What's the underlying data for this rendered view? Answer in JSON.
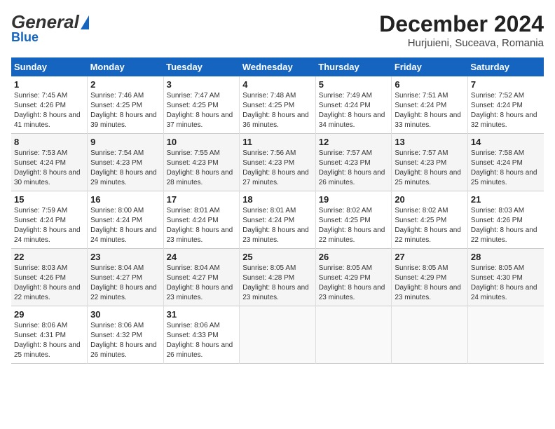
{
  "header": {
    "logo_general": "General",
    "logo_blue": "Blue",
    "title": "December 2024",
    "subtitle": "Hurjuieni, Suceava, Romania"
  },
  "calendar": {
    "days_of_week": [
      "Sunday",
      "Monday",
      "Tuesday",
      "Wednesday",
      "Thursday",
      "Friday",
      "Saturday"
    ],
    "weeks": [
      [
        {
          "day": "",
          "sunrise": "",
          "sunset": "",
          "daylight": ""
        },
        {
          "day": "2",
          "sunrise": "Sunrise: 7:46 AM",
          "sunset": "Sunset: 4:25 PM",
          "daylight": "Daylight: 8 hours and 39 minutes."
        },
        {
          "day": "3",
          "sunrise": "Sunrise: 7:47 AM",
          "sunset": "Sunset: 4:25 PM",
          "daylight": "Daylight: 8 hours and 37 minutes."
        },
        {
          "day": "4",
          "sunrise": "Sunrise: 7:48 AM",
          "sunset": "Sunset: 4:25 PM",
          "daylight": "Daylight: 8 hours and 36 minutes."
        },
        {
          "day": "5",
          "sunrise": "Sunrise: 7:49 AM",
          "sunset": "Sunset: 4:24 PM",
          "daylight": "Daylight: 8 hours and 34 minutes."
        },
        {
          "day": "6",
          "sunrise": "Sunrise: 7:51 AM",
          "sunset": "Sunset: 4:24 PM",
          "daylight": "Daylight: 8 hours and 33 minutes."
        },
        {
          "day": "7",
          "sunrise": "Sunrise: 7:52 AM",
          "sunset": "Sunset: 4:24 PM",
          "daylight": "Daylight: 8 hours and 32 minutes."
        }
      ],
      [
        {
          "day": "1",
          "sunrise": "Sunrise: 7:45 AM",
          "sunset": "Sunset: 4:26 PM",
          "daylight": "Daylight: 8 hours and 41 minutes."
        },
        {
          "day": "",
          "sunrise": "",
          "sunset": "",
          "daylight": ""
        },
        {
          "day": "",
          "sunrise": "",
          "sunset": "",
          "daylight": ""
        },
        {
          "day": "",
          "sunrise": "",
          "sunset": "",
          "daylight": ""
        },
        {
          "day": "",
          "sunrise": "",
          "sunset": "",
          "daylight": ""
        },
        {
          "day": "",
          "sunrise": "",
          "sunset": "",
          "daylight": ""
        },
        {
          "day": "",
          "sunrise": "",
          "sunset": "",
          "daylight": ""
        }
      ],
      [
        {
          "day": "8",
          "sunrise": "Sunrise: 7:53 AM",
          "sunset": "Sunset: 4:24 PM",
          "daylight": "Daylight: 8 hours and 30 minutes."
        },
        {
          "day": "9",
          "sunrise": "Sunrise: 7:54 AM",
          "sunset": "Sunset: 4:23 PM",
          "daylight": "Daylight: 8 hours and 29 minutes."
        },
        {
          "day": "10",
          "sunrise": "Sunrise: 7:55 AM",
          "sunset": "Sunset: 4:23 PM",
          "daylight": "Daylight: 8 hours and 28 minutes."
        },
        {
          "day": "11",
          "sunrise": "Sunrise: 7:56 AM",
          "sunset": "Sunset: 4:23 PM",
          "daylight": "Daylight: 8 hours and 27 minutes."
        },
        {
          "day": "12",
          "sunrise": "Sunrise: 7:57 AM",
          "sunset": "Sunset: 4:23 PM",
          "daylight": "Daylight: 8 hours and 26 minutes."
        },
        {
          "day": "13",
          "sunrise": "Sunrise: 7:57 AM",
          "sunset": "Sunset: 4:23 PM",
          "daylight": "Daylight: 8 hours and 25 minutes."
        },
        {
          "day": "14",
          "sunrise": "Sunrise: 7:58 AM",
          "sunset": "Sunset: 4:24 PM",
          "daylight": "Daylight: 8 hours and 25 minutes."
        }
      ],
      [
        {
          "day": "15",
          "sunrise": "Sunrise: 7:59 AM",
          "sunset": "Sunset: 4:24 PM",
          "daylight": "Daylight: 8 hours and 24 minutes."
        },
        {
          "day": "16",
          "sunrise": "Sunrise: 8:00 AM",
          "sunset": "Sunset: 4:24 PM",
          "daylight": "Daylight: 8 hours and 24 minutes."
        },
        {
          "day": "17",
          "sunrise": "Sunrise: 8:01 AM",
          "sunset": "Sunset: 4:24 PM",
          "daylight": "Daylight: 8 hours and 23 minutes."
        },
        {
          "day": "18",
          "sunrise": "Sunrise: 8:01 AM",
          "sunset": "Sunset: 4:24 PM",
          "daylight": "Daylight: 8 hours and 23 minutes."
        },
        {
          "day": "19",
          "sunrise": "Sunrise: 8:02 AM",
          "sunset": "Sunset: 4:25 PM",
          "daylight": "Daylight: 8 hours and 22 minutes."
        },
        {
          "day": "20",
          "sunrise": "Sunrise: 8:02 AM",
          "sunset": "Sunset: 4:25 PM",
          "daylight": "Daylight: 8 hours and 22 minutes."
        },
        {
          "day": "21",
          "sunrise": "Sunrise: 8:03 AM",
          "sunset": "Sunset: 4:26 PM",
          "daylight": "Daylight: 8 hours and 22 minutes."
        }
      ],
      [
        {
          "day": "22",
          "sunrise": "Sunrise: 8:03 AM",
          "sunset": "Sunset: 4:26 PM",
          "daylight": "Daylight: 8 hours and 22 minutes."
        },
        {
          "day": "23",
          "sunrise": "Sunrise: 8:04 AM",
          "sunset": "Sunset: 4:27 PM",
          "daylight": "Daylight: 8 hours and 22 minutes."
        },
        {
          "day": "24",
          "sunrise": "Sunrise: 8:04 AM",
          "sunset": "Sunset: 4:27 PM",
          "daylight": "Daylight: 8 hours and 23 minutes."
        },
        {
          "day": "25",
          "sunrise": "Sunrise: 8:05 AM",
          "sunset": "Sunset: 4:28 PM",
          "daylight": "Daylight: 8 hours and 23 minutes."
        },
        {
          "day": "26",
          "sunrise": "Sunrise: 8:05 AM",
          "sunset": "Sunset: 4:29 PM",
          "daylight": "Daylight: 8 hours and 23 minutes."
        },
        {
          "day": "27",
          "sunrise": "Sunrise: 8:05 AM",
          "sunset": "Sunset: 4:29 PM",
          "daylight": "Daylight: 8 hours and 23 minutes."
        },
        {
          "day": "28",
          "sunrise": "Sunrise: 8:05 AM",
          "sunset": "Sunset: 4:30 PM",
          "daylight": "Daylight: 8 hours and 24 minutes."
        }
      ],
      [
        {
          "day": "29",
          "sunrise": "Sunrise: 8:06 AM",
          "sunset": "Sunset: 4:31 PM",
          "daylight": "Daylight: 8 hours and 25 minutes."
        },
        {
          "day": "30",
          "sunrise": "Sunrise: 8:06 AM",
          "sunset": "Sunset: 4:32 PM",
          "daylight": "Daylight: 8 hours and 26 minutes."
        },
        {
          "day": "31",
          "sunrise": "Sunrise: 8:06 AM",
          "sunset": "Sunset: 4:33 PM",
          "daylight": "Daylight: 8 hours and 26 minutes."
        },
        {
          "day": "",
          "sunrise": "",
          "sunset": "",
          "daylight": ""
        },
        {
          "day": "",
          "sunrise": "",
          "sunset": "",
          "daylight": ""
        },
        {
          "day": "",
          "sunrise": "",
          "sunset": "",
          "daylight": ""
        },
        {
          "day": "",
          "sunrise": "",
          "sunset": "",
          "daylight": ""
        }
      ]
    ]
  }
}
